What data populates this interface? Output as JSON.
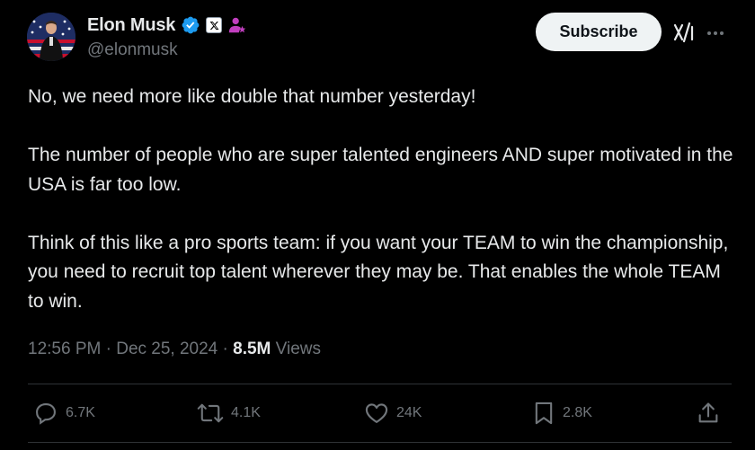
{
  "author": {
    "display_name": "Elon Musk",
    "handle": "@elonmusk",
    "verified_color": "#1d9bf0",
    "affiliate_badge_color": "#c13fbf"
  },
  "header": {
    "subscribe_label": "Subscribe",
    "grok_icon": "grok-icon",
    "more_icon": "more-options-icon"
  },
  "tweet": {
    "paragraphs": [
      "No, we need more like double that number yesterday!",
      "The number of people who are super talented engineers AND super motivated in the USA is far too low.",
      "Think of this like a pro sports team: if you want your TEAM to win the championship, you need to recruit top talent wherever they may be. That enables the whole TEAM to win."
    ]
  },
  "meta": {
    "time": "12:56 PM",
    "separator": " · ",
    "date": "Dec 25, 2024",
    "views_count": "8.5M",
    "views_label": "Views"
  },
  "actions": {
    "replies": "6.7K",
    "reposts": "4.1K",
    "likes": "24K",
    "bookmarks": "2.8K"
  },
  "colors": {
    "background": "#000000",
    "text": "#e7e9ea",
    "muted": "#71767b",
    "divider": "#2f3336",
    "button_bg": "#eff3f4"
  }
}
